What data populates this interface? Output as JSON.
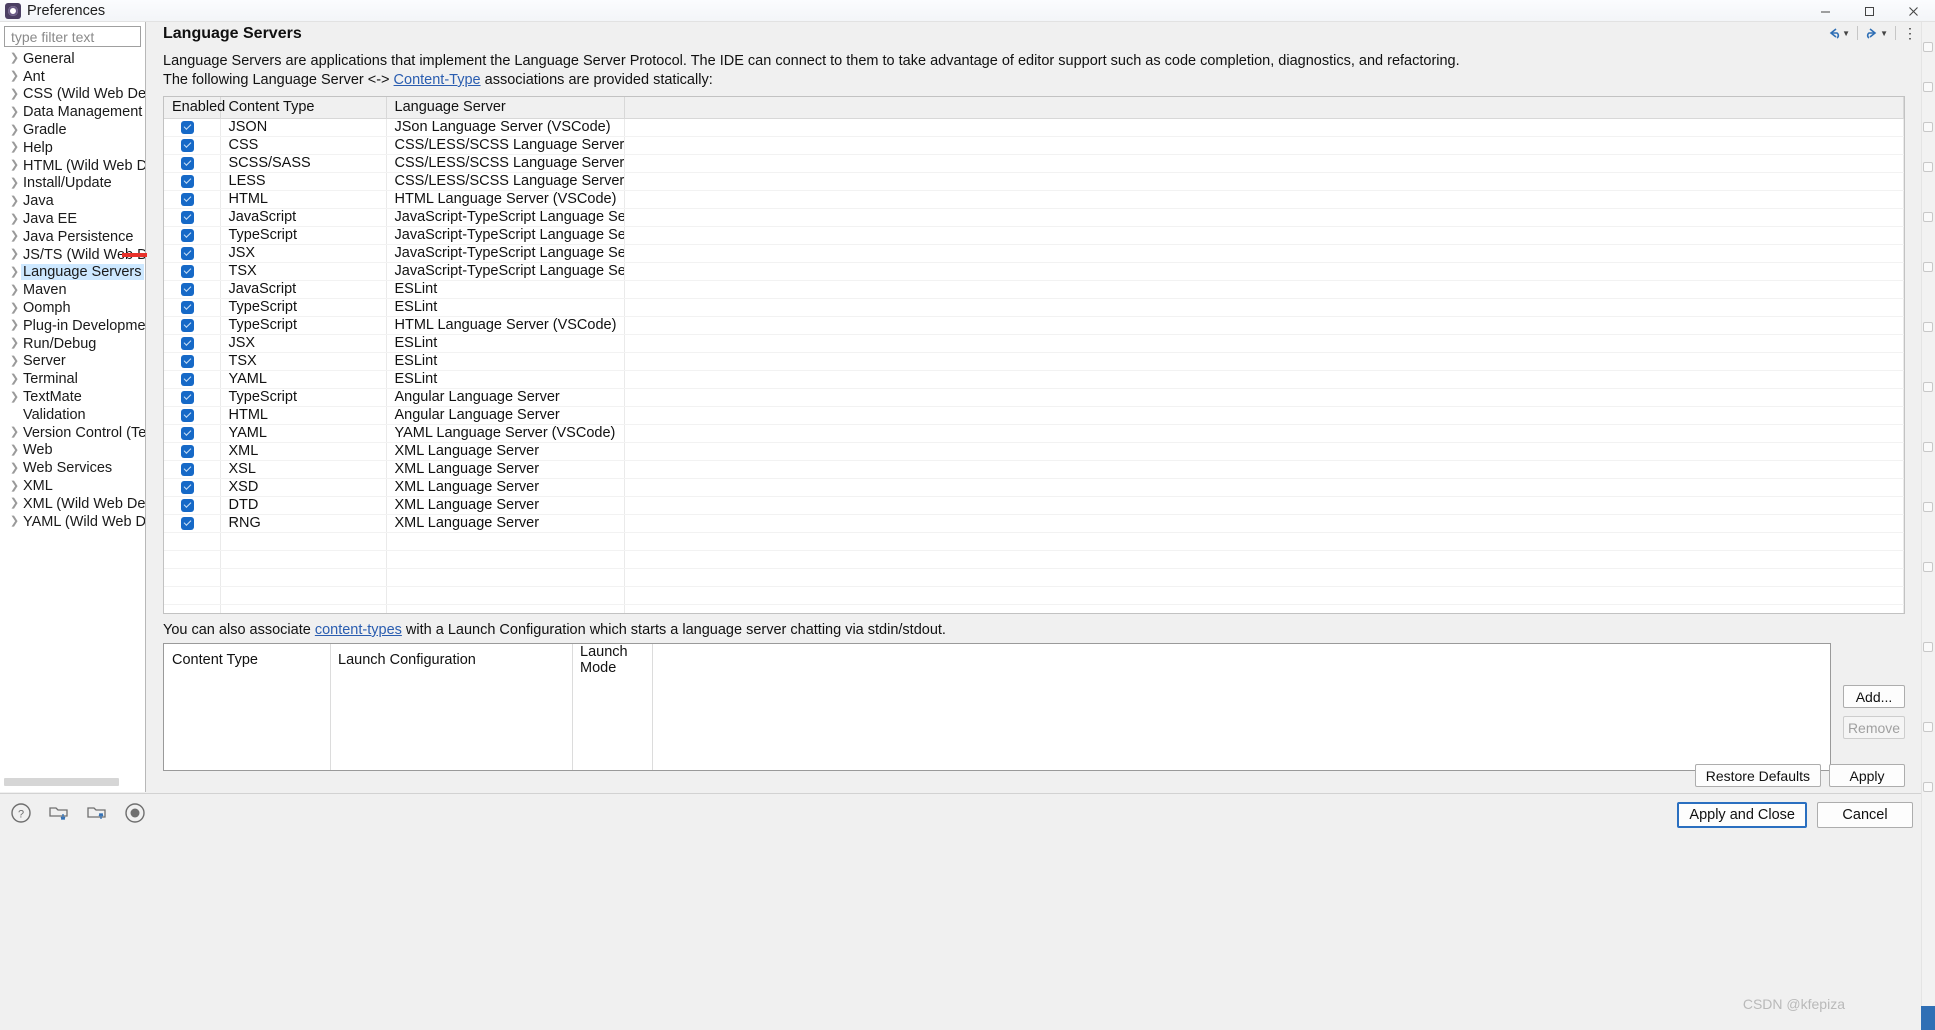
{
  "window": {
    "title": "Preferences",
    "icon": "preferences-gear-icon",
    "minimize_label": "—",
    "maximize_label": "□",
    "close_label": "✕"
  },
  "sidebar": {
    "filter_placeholder": "type filter text",
    "filter_value": "",
    "items": [
      {
        "label": "General",
        "expandable": true,
        "selected": false
      },
      {
        "label": "Ant",
        "expandable": true,
        "selected": false
      },
      {
        "label": "CSS (Wild Web Develope",
        "expandable": true,
        "selected": false
      },
      {
        "label": "Data Management",
        "expandable": true,
        "selected": false
      },
      {
        "label": "Gradle",
        "expandable": true,
        "selected": false
      },
      {
        "label": "Help",
        "expandable": true,
        "selected": false
      },
      {
        "label": "HTML (Wild Web Develop",
        "expandable": true,
        "selected": false
      },
      {
        "label": "Install/Update",
        "expandable": true,
        "selected": false
      },
      {
        "label": "Java",
        "expandable": true,
        "selected": false
      },
      {
        "label": "Java EE",
        "expandable": true,
        "selected": false
      },
      {
        "label": "Java Persistence",
        "expandable": true,
        "selected": false
      },
      {
        "label": "JS/TS (Wild Web Develop",
        "expandable": true,
        "selected": false
      },
      {
        "label": "Language Servers",
        "expandable": true,
        "selected": true
      },
      {
        "label": "Maven",
        "expandable": true,
        "selected": false
      },
      {
        "label": "Oomph",
        "expandable": true,
        "selected": false
      },
      {
        "label": "Plug-in Development",
        "expandable": true,
        "selected": false
      },
      {
        "label": "Run/Debug",
        "expandable": true,
        "selected": false
      },
      {
        "label": "Server",
        "expandable": true,
        "selected": false
      },
      {
        "label": "Terminal",
        "expandable": true,
        "selected": false
      },
      {
        "label": "TextMate",
        "expandable": true,
        "selected": false
      },
      {
        "label": "Validation",
        "expandable": false,
        "selected": false
      },
      {
        "label": "Version Control (Team)",
        "expandable": true,
        "selected": false
      },
      {
        "label": "Web",
        "expandable": true,
        "selected": false
      },
      {
        "label": "Web Services",
        "expandable": true,
        "selected": false
      },
      {
        "label": "XML",
        "expandable": true,
        "selected": false
      },
      {
        "label": "XML (Wild Web Develop",
        "expandable": true,
        "selected": false
      },
      {
        "label": "YAML (Wild Web Develop",
        "expandable": true,
        "selected": false
      }
    ]
  },
  "page": {
    "title": "Language Servers",
    "description_line1": "Language Servers are applications that implement the Language Server Protocol. The IDE can connect to them to take advantage of editor support such as code completion, diagnostics, and refactoring.",
    "desc_line2_pre": "The following Language Server <-> ",
    "desc_line2_link": "Content-Type",
    "desc_line2_post": " associations are provided statically:",
    "assoc_pre": "You can also associate ",
    "assoc_link": "content-types",
    "assoc_post": " with a Launch Configuration which starts a language server chatting via stdin/stdout."
  },
  "main_table": {
    "columns": [
      "Enabled",
      "Content Type",
      "Language Server",
      ""
    ],
    "rows": [
      {
        "enabled": true,
        "content_type": "JSON",
        "server": "JSon Language Server (VSCode)"
      },
      {
        "enabled": true,
        "content_type": "CSS",
        "server": "CSS/LESS/SCSS Language Server (VSCode)"
      },
      {
        "enabled": true,
        "content_type": "SCSS/SASS",
        "server": "CSS/LESS/SCSS Language Server (VSCode)"
      },
      {
        "enabled": true,
        "content_type": "LESS",
        "server": "CSS/LESS/SCSS Language Server (VSCode)"
      },
      {
        "enabled": true,
        "content_type": "HTML",
        "server": "HTML Language Server (VSCode)"
      },
      {
        "enabled": true,
        "content_type": "JavaScript",
        "server": "JavaScript-TypeScript Language Server"
      },
      {
        "enabled": true,
        "content_type": "TypeScript",
        "server": "JavaScript-TypeScript Language Server"
      },
      {
        "enabled": true,
        "content_type": "JSX",
        "server": "JavaScript-TypeScript Language Server"
      },
      {
        "enabled": true,
        "content_type": "TSX",
        "server": "JavaScript-TypeScript Language Server"
      },
      {
        "enabled": true,
        "content_type": "JavaScript",
        "server": "ESLint"
      },
      {
        "enabled": true,
        "content_type": "TypeScript",
        "server": "ESLint"
      },
      {
        "enabled": true,
        "content_type": "TypeScript",
        "server": "HTML Language Server (VSCode)"
      },
      {
        "enabled": true,
        "content_type": "JSX",
        "server": "ESLint"
      },
      {
        "enabled": true,
        "content_type": "TSX",
        "server": "ESLint"
      },
      {
        "enabled": true,
        "content_type": "YAML",
        "server": "ESLint"
      },
      {
        "enabled": true,
        "content_type": "TypeScript",
        "server": "Angular Language Server"
      },
      {
        "enabled": true,
        "content_type": "HTML",
        "server": "Angular Language Server"
      },
      {
        "enabled": true,
        "content_type": "YAML",
        "server": "YAML Language Server (VSCode)"
      },
      {
        "enabled": true,
        "content_type": "XML",
        "server": "XML Language Server"
      },
      {
        "enabled": true,
        "content_type": "XSL",
        "server": "XML Language Server"
      },
      {
        "enabled": true,
        "content_type": "XSD",
        "server": "XML Language Server"
      },
      {
        "enabled": true,
        "content_type": "DTD",
        "server": "XML Language Server"
      },
      {
        "enabled": true,
        "content_type": "RNG",
        "server": "XML Language Server"
      }
    ],
    "empty_rows": 5
  },
  "lower_table": {
    "columns": [
      "Content Type",
      "Launch Configuration",
      "Launch Mode"
    ],
    "rows": []
  },
  "buttons": {
    "add": "Add...",
    "remove": "Remove",
    "restore_defaults": "Restore Defaults",
    "apply": "Apply",
    "apply_and_close": "Apply and Close",
    "cancel": "Cancel"
  },
  "watermark": "CSDN @kfepiza",
  "colors": {
    "accent": "#1669c7",
    "link": "#2a5db0",
    "selection": "#cde8ff",
    "annotation_arrow": "#e8312a"
  }
}
